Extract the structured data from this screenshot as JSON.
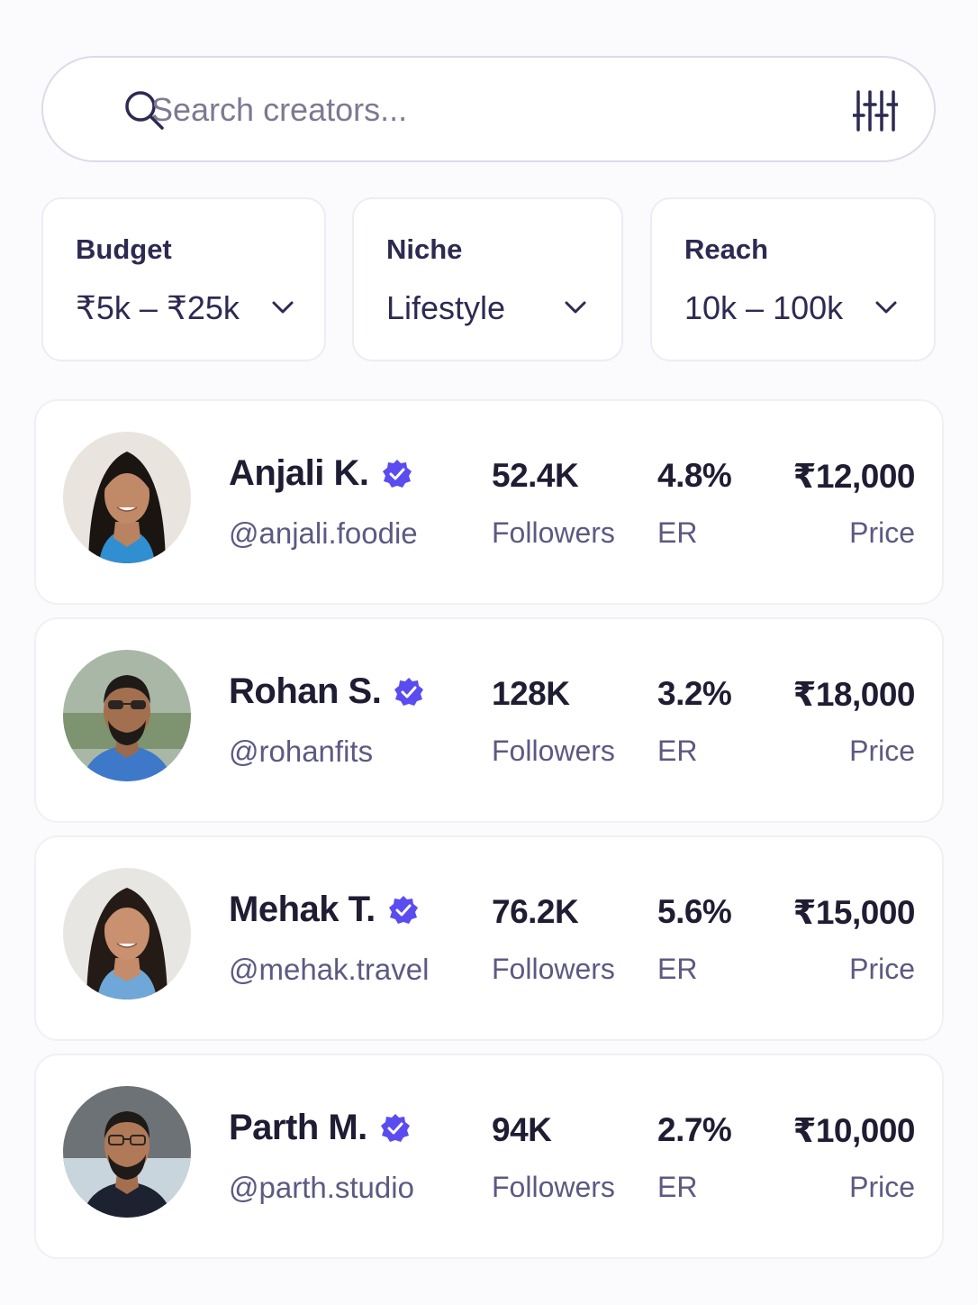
{
  "search": {
    "placeholder": "Search creators...",
    "icon": "search-icon",
    "filter_icon": "sliders-icon"
  },
  "filters": [
    {
      "label": "Budget",
      "value": "₹5k – ₹25k"
    },
    {
      "label": "Niche",
      "value": "Lifestyle"
    },
    {
      "label": "Reach",
      "value": "10k – 100k"
    }
  ],
  "creators": [
    {
      "name": "Anjali K.",
      "handle": "@anjali.foodie",
      "followers": "52.4K",
      "followers_label": "Followers",
      "er": "4.8%",
      "er_label": "ER",
      "price": "₹12,000",
      "price_label": "Price"
    },
    {
      "name": "Rohan S.",
      "handle": "@rohanfits",
      "followers": "128K",
      "followers_label": "Followers",
      "er": "3.2%",
      "er_label": "ER",
      "price": "₹18,000",
      "price_label": "Price"
    },
    {
      "name": "Mehak T.",
      "handle": "@mehak.travel",
      "followers": "76.2K",
      "followers_label": "Followers",
      "er": "5.6%",
      "er_label": "ER",
      "price": "₹15,000",
      "price_label": "Price"
    },
    {
      "name": "Parth M.",
      "handle": "@parth.studio",
      "followers": "94K",
      "followers_label": "Followers",
      "er": "2.7%",
      "er_label": "ER",
      "price": "₹10,000",
      "price_label": "Price"
    }
  ],
  "colors": {
    "accent": "#5b4cf0",
    "text_primary": "#1f1d33",
    "text_secondary": "#5c5a82"
  }
}
